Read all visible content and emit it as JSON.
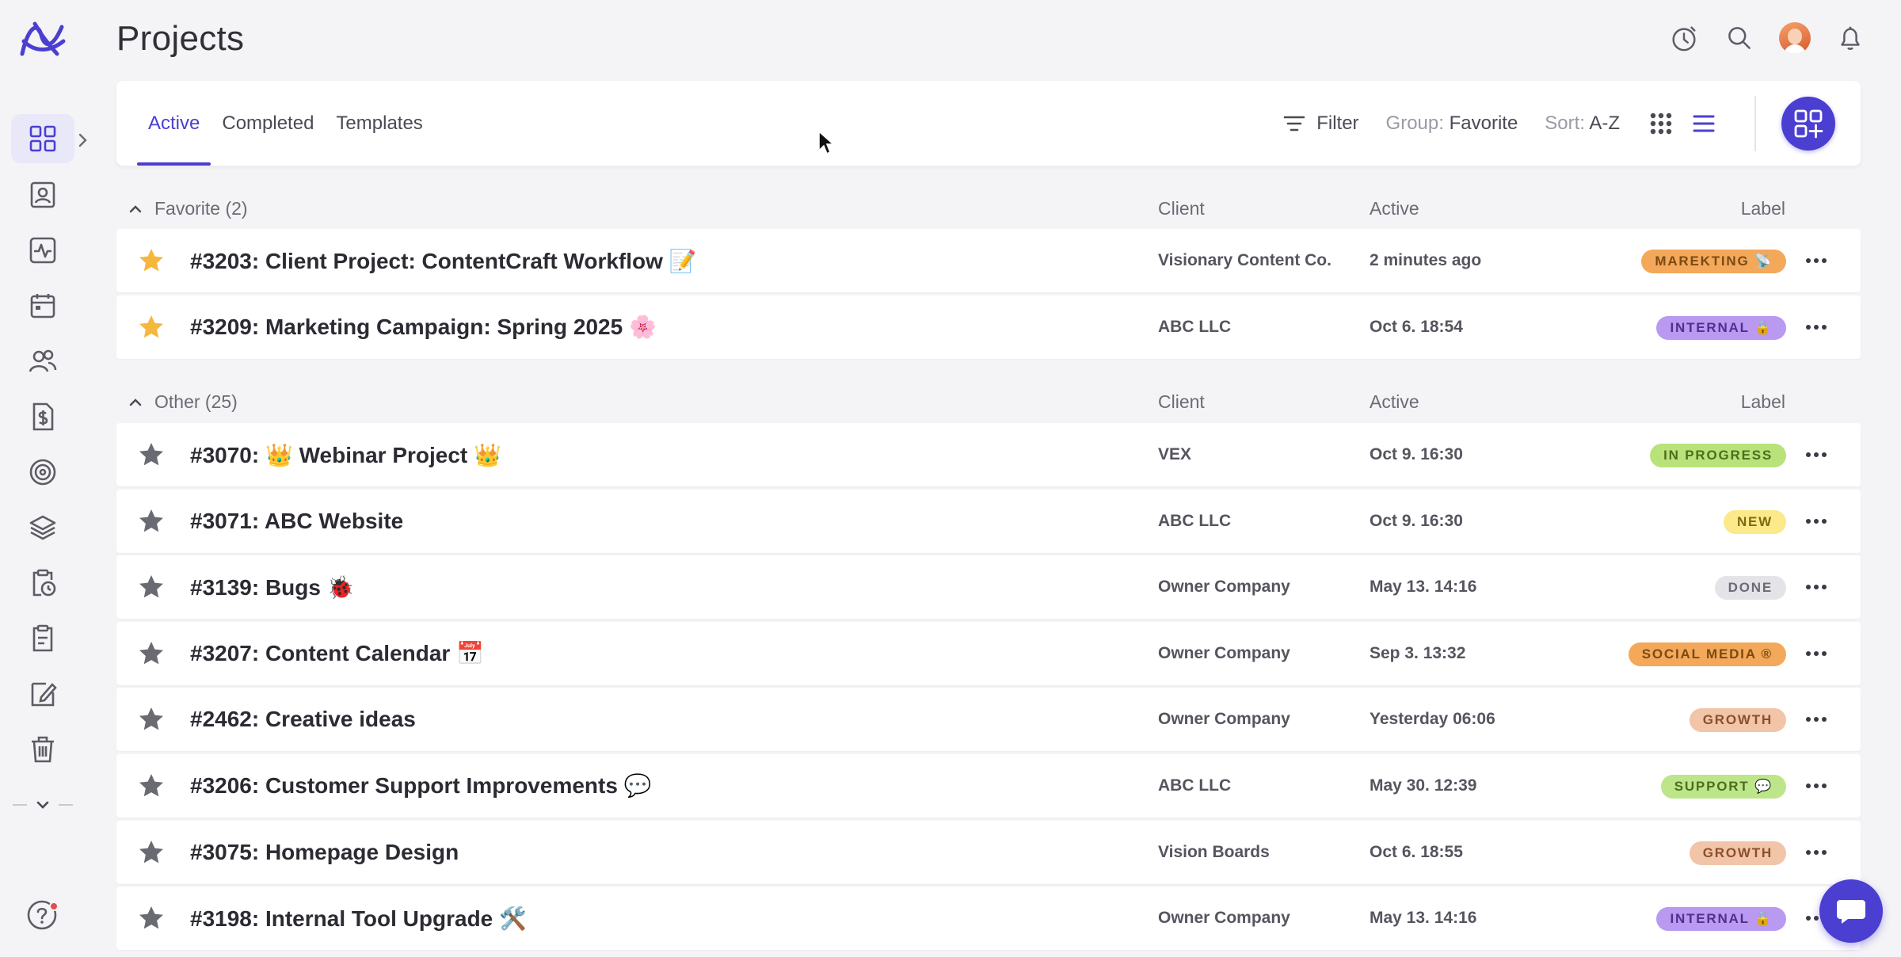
{
  "page": {
    "title": "Projects"
  },
  "tabs": [
    {
      "label": "Active",
      "active": true
    },
    {
      "label": "Completed",
      "active": false
    },
    {
      "label": "Templates",
      "active": false
    }
  ],
  "toolbar": {
    "filter_label": "Filter",
    "group_prefix": "Group:",
    "group_value": "Favorite",
    "sort_prefix": "Sort:",
    "sort_value": "A-Z"
  },
  "columns": {
    "client": "Client",
    "active": "Active",
    "label": "Label"
  },
  "groups": {
    "favorite": {
      "title": "Favorite (2)",
      "rows": [
        {
          "name": "#3203: Client Project: ContentCraft Workflow 📝",
          "client": "Visionary Content Co.",
          "active": "2 minutes ago",
          "label": "MAREKTING 📡",
          "starred": true
        },
        {
          "name": "#3209: Marketing Campaign: Spring 2025 🌸",
          "client": "ABC LLC",
          "active": "Oct 6. 18:54",
          "label": "INTERNAL 🔒",
          "starred": true
        }
      ]
    },
    "other": {
      "title": "Other (25)",
      "rows": [
        {
          "name": "#3070: 👑 Webinar Project 👑",
          "client": "VEX",
          "active": "Oct 9. 16:30",
          "label": "IN PROGRESS",
          "starred": false
        },
        {
          "name": "#3071: ABC Website",
          "client": "ABC LLC",
          "active": "Oct 9. 16:30",
          "label": "NEW",
          "starred": false
        },
        {
          "name": "#3139: Bugs 🐞",
          "client": "Owner Company",
          "active": "May 13. 14:16",
          "label": "DONE",
          "starred": false
        },
        {
          "name": "#3207: Content Calendar 📅",
          "client": "Owner Company",
          "active": "Sep 3. 13:32",
          "label": "SOCIAL MEDIA ®",
          "starred": false
        },
        {
          "name": "#2462: Creative ideas",
          "client": "Owner Company",
          "active": "Yesterday 06:06",
          "label": "GROWTH",
          "starred": false
        },
        {
          "name": "#3206: Customer Support Improvements 💬",
          "client": "ABC LLC",
          "active": "May 30. 12:39",
          "label": "SUPPORT 💬",
          "starred": false
        },
        {
          "name": "#3075: Homepage Design",
          "client": "Vision Boards",
          "active": "Oct 6. 18:55",
          "label": "GROWTH",
          "starred": false
        },
        {
          "name": "#3198: Internal Tool Upgrade 🛠️",
          "client": "Owner Company",
          "active": "May 13. 14:16",
          "label": "INTERNAL 🔒",
          "starred": false
        }
      ]
    }
  },
  "badge_colors": {
    "MAREKTING 📡": {
      "bg": "#f3a85a",
      "fg": "#7a4a14"
    },
    "INTERNAL 🔒": {
      "bg": "#b99af0",
      "fg": "#4f2f8f"
    },
    "IN PROGRESS": {
      "bg": "#b9e27a",
      "fg": "#4c6e1c"
    },
    "NEW": {
      "bg": "#fbe98a",
      "fg": "#7d6a10"
    },
    "DONE": {
      "bg": "#e4e4e8",
      "fg": "#6b6b76"
    },
    "SOCIAL MEDIA ®": {
      "bg": "#f3a85a",
      "fg": "#7a4a14"
    },
    "GROWTH": {
      "bg": "#f2c4a8",
      "fg": "#8a4f2c"
    },
    "SUPPORT 💬": {
      "bg": "#bde58a",
      "fg": "#4c6e1c"
    }
  },
  "colors": {
    "accent": "#4b3fd1",
    "star_favorite": "#f5b83d",
    "star_default": "#6a6a72"
  }
}
